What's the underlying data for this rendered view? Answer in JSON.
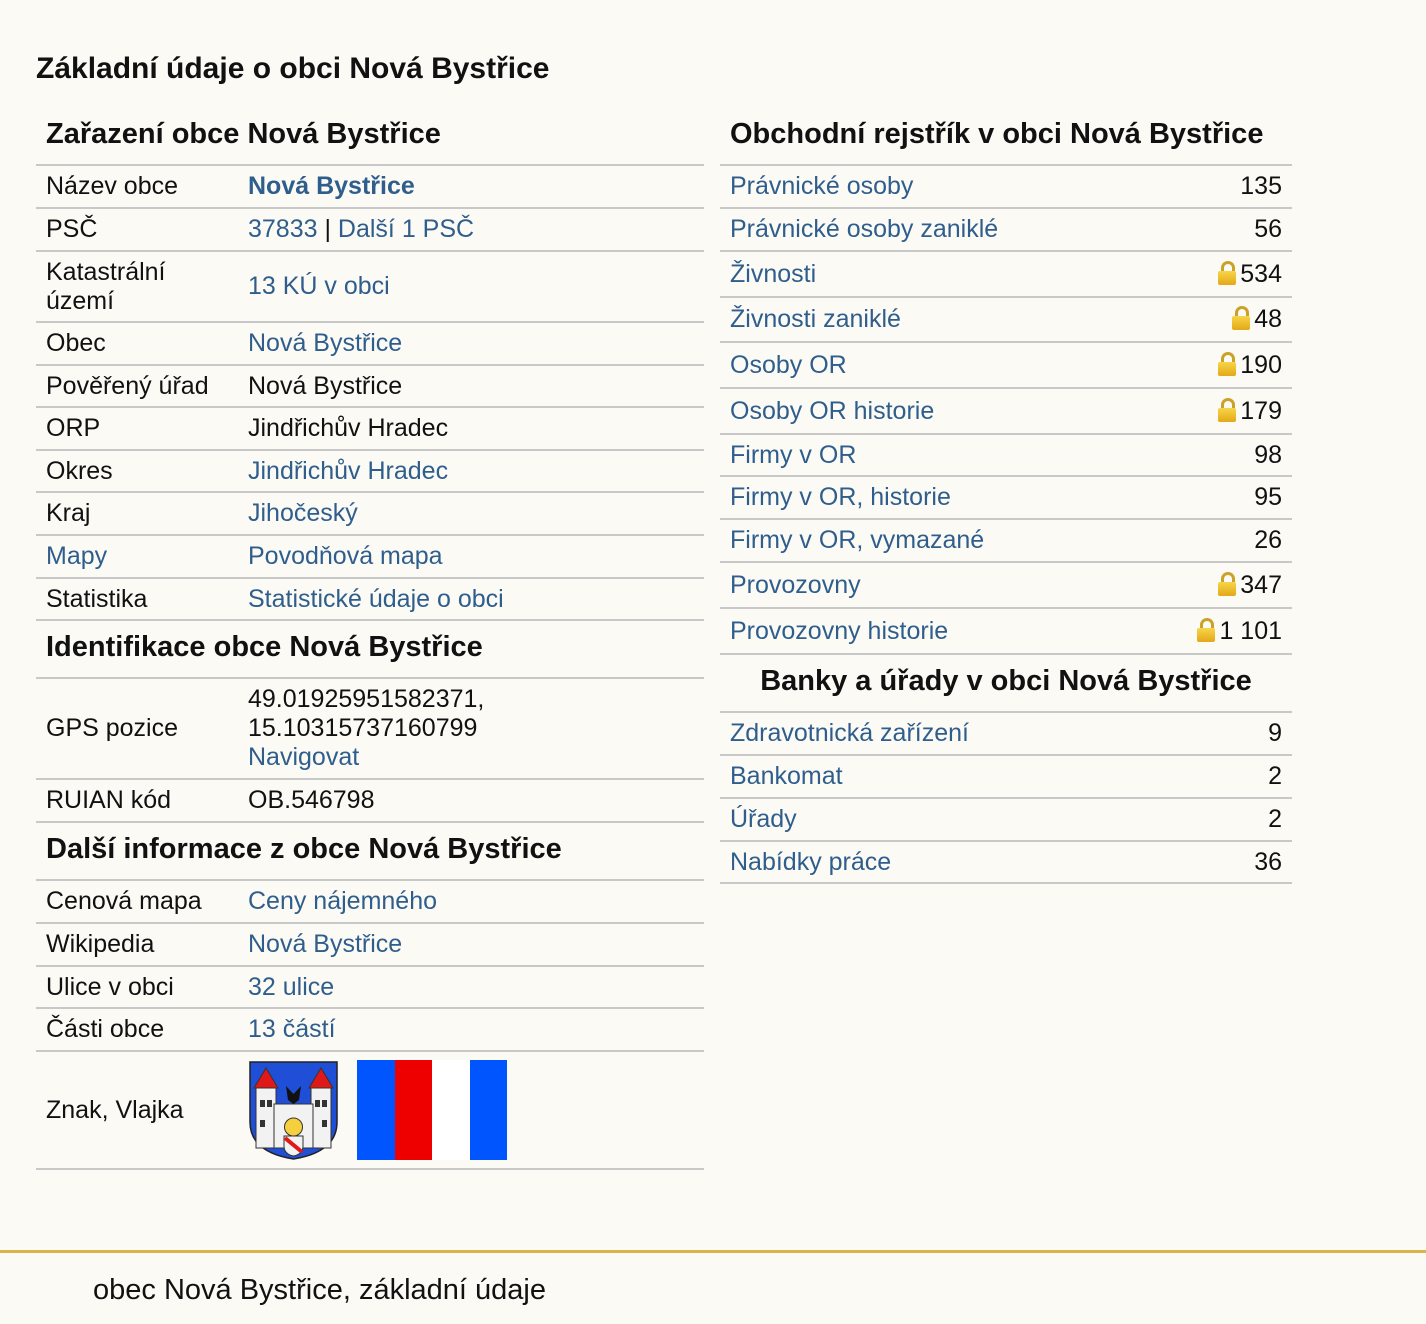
{
  "page_title": "Základní údaje o obci Nová Bystřice",
  "zarazeni": {
    "title": "Zařazení obce Nová Bystřice",
    "rows": [
      {
        "label": "Název obce",
        "value": "Nová Bystřice"
      },
      {
        "label": "PSČ",
        "value_a": "37833",
        "sep": " | ",
        "value_b": "Další 1 PSČ"
      },
      {
        "label": "Katastrální území",
        "value": "13 KÚ v obci"
      },
      {
        "label": "Obec",
        "value": "Nová Bystřice"
      },
      {
        "label": "Pověřený úřad",
        "value": "Nová Bystřice"
      },
      {
        "label": "ORP",
        "value": "Jindřichův Hradec"
      },
      {
        "label": "Okres",
        "value": "Jindřichův Hradec"
      },
      {
        "label": "Kraj",
        "value": "Jihočeský"
      },
      {
        "label": "Mapy",
        "value": "Povodňová mapa"
      },
      {
        "label": "Statistika",
        "value": "Statistické údaje o obci"
      }
    ]
  },
  "identifikace": {
    "title": "Identifikace obce Nová Bystřice",
    "gps_label": "GPS pozice",
    "gps_lat": "49.01925951582371,",
    "gps_lon": "15.10315737160799",
    "navigate": "Navigovat",
    "ruian_label": "RUIAN kód",
    "ruian_value": "OB.546798"
  },
  "dalsi": {
    "title": "Další informace z obce Nová Bystřice",
    "rows": [
      {
        "label": "Cenová mapa",
        "value": "Ceny nájemného"
      },
      {
        "label": "Wikipedia",
        "value": "Nová Bystřice"
      },
      {
        "label": "Ulice v obci",
        "value": "32 ulice"
      },
      {
        "label": "Části obce",
        "value": "13 částí"
      }
    ],
    "znak_label": "Znak, Vlajka",
    "flag_colors": [
      "#0055ff",
      "#ee0000",
      "#ffffff",
      "#0055ff"
    ]
  },
  "obchodni": {
    "title": "Obchodní rejstřík v obci Nová Bystřice",
    "rows": [
      {
        "label": "Právnické osoby",
        "count": "135"
      },
      {
        "label": "Právnické osoby zaniklé",
        "count": "56"
      },
      {
        "label": "Živnosti",
        "count": "534",
        "lock": true
      },
      {
        "label": "Živnosti zaniklé",
        "count": "48",
        "lock": true
      },
      {
        "label": "Osoby OR",
        "count": "190",
        "lock": true
      },
      {
        "label": "Osoby OR historie",
        "count": "179",
        "lock": true
      },
      {
        "label": "Firmy v OR",
        "count": "98"
      },
      {
        "label": "Firmy v OR, historie",
        "count": "95"
      },
      {
        "label": "Firmy v OR, vymazané",
        "count": "26"
      },
      {
        "label": "Provozovny",
        "count": "347",
        "lock": true
      },
      {
        "label": "Provozovny historie",
        "count": "1 101",
        "lock": true
      }
    ]
  },
  "banky": {
    "title": "Banky a úřady v obci Nová Bystřice",
    "rows": [
      {
        "label": "Zdravotnická zařízení",
        "count": "9"
      },
      {
        "label": "Bankomat",
        "count": "2"
      },
      {
        "label": "Úřady",
        "count": "2"
      },
      {
        "label": "Nabídky práce",
        "count": "36"
      }
    ]
  },
  "footer": "obec Nová Bystřice, základní údaje",
  "colors": {
    "link": "#2f5e8c",
    "border": "#c8c8c8",
    "footer_line": "#d8b548",
    "background": "#fbfaf5"
  }
}
